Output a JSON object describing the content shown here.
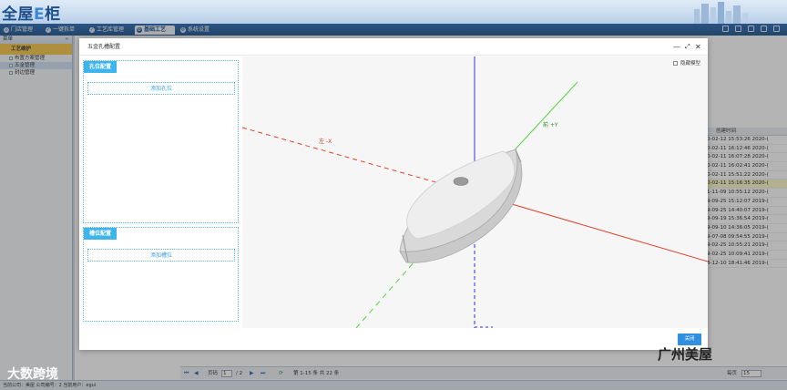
{
  "app": {
    "logo_text": "全屋",
    "logo_e": "E",
    "logo_tail": "柜"
  },
  "nav": {
    "tabs": [
      {
        "label": "门店管理"
      },
      {
        "label": "一键拆单"
      },
      {
        "label": "工艺库管理"
      },
      {
        "label": "基础工艺"
      },
      {
        "label": "系统设置"
      }
    ]
  },
  "sidebar": {
    "header": "菜单",
    "section": "工艺维护",
    "items": [
      {
        "label": "布置方案管理"
      },
      {
        "label": "五金管理"
      },
      {
        "label": "封边管理"
      }
    ]
  },
  "table": {
    "header": "创建时间",
    "rows": [
      "0-02-12 15:53:26  2020-(",
      "0-02-11 16:12:46  2020-(",
      "0-02-11 16:07:28  2020-(",
      "0-02-11 16:02:41  2020-(",
      "0-02-11 15:51:22  2020-(",
      "0-02-11 15:16:35  2020-(",
      "1-11-09 10:55:12  2020-(",
      "9-09-25 15:12:07  2019-(",
      "9-09-25 14:40:07  2019-(",
      "9-09-19 15:36:54  2019-(",
      "9-09-10 14:36:05  2019-(",
      "9-07-08 09:54:55  2019-(",
      "9-02-25 10:55:21  2019-(",
      "9-02-25 10:09:41  2019-(",
      "8-12-10 18:41:46  2019-("
    ]
  },
  "pager": {
    "page_label": "页码",
    "page_value": "1",
    "total_pages": "/ 2",
    "summary": "第 1-15 条  共 22 条",
    "per_page_label": "每页",
    "per_page_value": "15"
  },
  "status_bar": {
    "text": "当前公司：美屋   公司编号：2   当前用户：egui"
  },
  "modal": {
    "title": "五金孔槽配置",
    "hole_panel_title": "孔位配置",
    "add_hole_label": "添加孔位",
    "slot_panel_title": "槽位配置",
    "add_slot_label": "添加槽位",
    "hide_model_label": "隐藏模型",
    "close_label": "关闭",
    "axis_x_label": "左 -X",
    "axis_y_label": "前 +Y"
  },
  "watermarks": {
    "left": "大数跨境",
    "right": "广州美屋"
  },
  "colors": {
    "nav_blue": "#1f558f",
    "panel_head": "#3eb4ec",
    "close_btn": "#2f8fe0",
    "axis_x": "#e0402a",
    "axis_y": "#4fd63a",
    "axis_z": "#3030e0",
    "highlight_row": "#fdf7c7",
    "sidebar_section": "#f5c64a"
  }
}
